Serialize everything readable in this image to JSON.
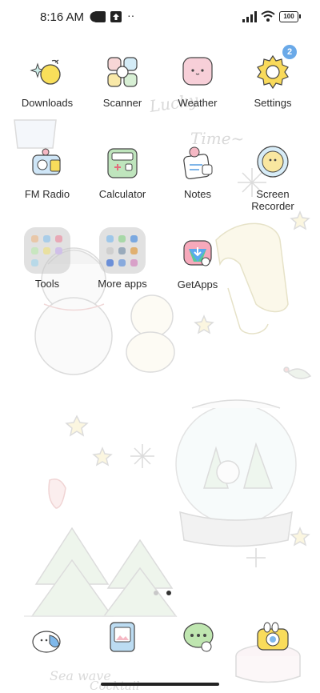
{
  "status_bar": {
    "time": "8:16 AM",
    "battery": "100",
    "more": "··"
  },
  "apps": [
    {
      "id": "downloads",
      "label": "Downloads",
      "icon": "downloads-icon"
    },
    {
      "id": "scanner",
      "label": "Scanner",
      "icon": "scanner-icon"
    },
    {
      "id": "weather",
      "label": "Weather",
      "icon": "weather-icon"
    },
    {
      "id": "settings",
      "label": "Settings",
      "icon": "settings-icon",
      "badge": "2"
    },
    {
      "id": "fm-radio",
      "label": "FM Radio",
      "icon": "fm-radio-icon"
    },
    {
      "id": "calculator",
      "label": "Calculator",
      "icon": "calculator-icon"
    },
    {
      "id": "notes",
      "label": "Notes",
      "icon": "notes-icon"
    },
    {
      "id": "screen-recorder",
      "label": "Screen\nRecorder",
      "icon": "screen-recorder-icon"
    },
    {
      "id": "tools",
      "label": "Tools",
      "icon": "tools-folder-icon"
    },
    {
      "id": "more-apps",
      "label": "More apps",
      "icon": "more-apps-folder-icon"
    },
    {
      "id": "getapps",
      "label": "GetApps",
      "icon": "getapps-icon"
    }
  ],
  "dock": [
    {
      "id": "dock-phone",
      "icon": "phone-icon"
    },
    {
      "id": "dock-gallery",
      "icon": "gallery-icon"
    },
    {
      "id": "dock-messages",
      "icon": "messages-icon"
    },
    {
      "id": "dock-camera",
      "icon": "camera-icon"
    }
  ],
  "page_indicator": {
    "count": 2,
    "active": 1
  },
  "wallpaper": {
    "text_lucky": "Lucky",
    "text_time": "Time~",
    "text_seawave": "Sea wave",
    "text_cocktail": "Cocktail"
  },
  "colors": {
    "accent_badge": "#6aa9e8",
    "label": "#2c2c2c"
  }
}
